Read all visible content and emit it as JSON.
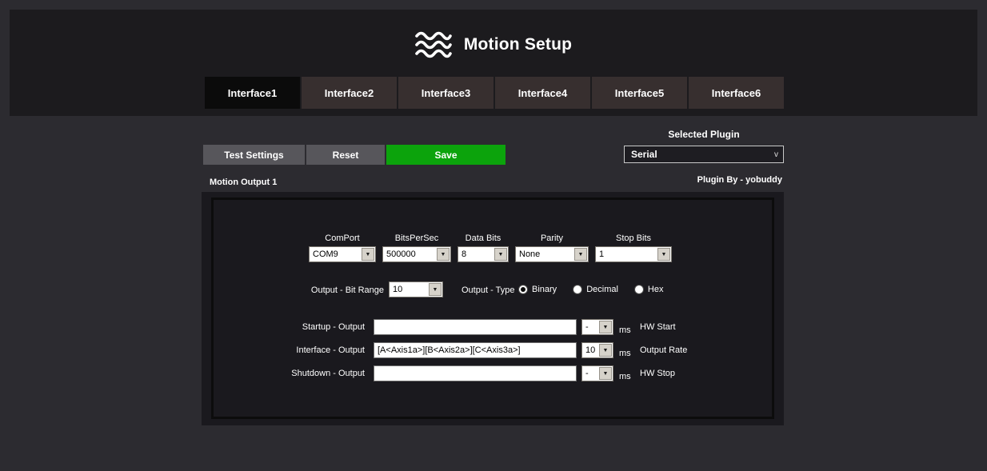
{
  "header": {
    "title": "Motion Setup"
  },
  "tabs": [
    {
      "label": "Interface1"
    },
    {
      "label": "Interface2"
    },
    {
      "label": "Interface3"
    },
    {
      "label": "Interface4"
    },
    {
      "label": "Interface5"
    },
    {
      "label": "Interface6"
    }
  ],
  "toolbar": {
    "test_settings_label": "Test Settings",
    "reset_label": "Reset",
    "save_label": "Save",
    "selected_plugin_label": "Selected Plugin",
    "plugin_selected": "Serial"
  },
  "icons": {
    "combo_arrow": "▼",
    "select_arrow": "v"
  },
  "output_panel": {
    "title": "Motion Output 1",
    "plugin_by": "Plugin By - yobuddy",
    "serial": {
      "comport": {
        "label": "ComPort",
        "value": "COM9"
      },
      "bitspersec": {
        "label": "BitsPerSec",
        "value": "500000"
      },
      "databits": {
        "label": "Data Bits",
        "value": "8"
      },
      "parity": {
        "label": "Parity",
        "value": "None"
      },
      "stopbits": {
        "label": "Stop Bits",
        "value": "1"
      }
    },
    "bit_range": {
      "label": "Output - Bit Range",
      "value": "10"
    },
    "output_type": {
      "label": "Output - Type",
      "options": [
        {
          "label": "Binary",
          "selected": true
        },
        {
          "label": "Decimal",
          "selected": false
        },
        {
          "label": "Hex",
          "selected": false
        }
      ]
    },
    "io_rows": [
      {
        "label": "Startup - Output",
        "value": "",
        "rate": "-",
        "unit": "ms",
        "tag": "HW Start"
      },
      {
        "label": "Interface - Output",
        "value": "[A<Axis1a>][B<Axis2a>][C<Axis3a>]",
        "rate": "10",
        "unit": "ms",
        "tag": "Output Rate"
      },
      {
        "label": "Shutdown - Output",
        "value": "",
        "rate": "-",
        "unit": "ms",
        "tag": "HW Stop"
      }
    ]
  }
}
